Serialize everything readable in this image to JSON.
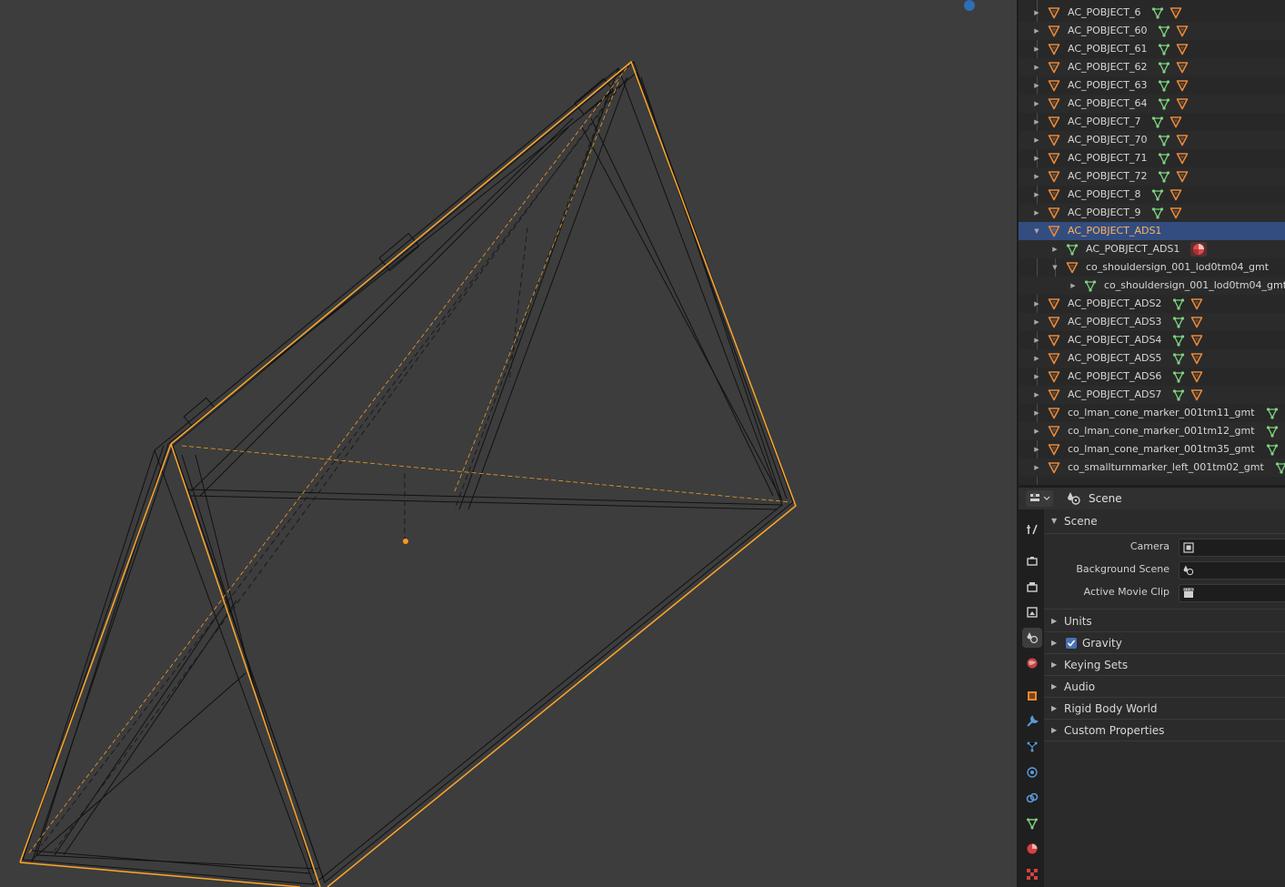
{
  "viewport": {
    "name": "3D Viewport"
  },
  "outliner": {
    "rows": [
      {
        "label": "AC_POBJECT_6",
        "indent": 0,
        "expanded": false,
        "type": "empty",
        "badges": [
          "mesh",
          "empty"
        ]
      },
      {
        "label": "AC_POBJECT_60",
        "indent": 0,
        "expanded": false,
        "type": "empty",
        "badges": [
          "mesh",
          "empty"
        ]
      },
      {
        "label": "AC_POBJECT_61",
        "indent": 0,
        "expanded": false,
        "type": "empty",
        "badges": [
          "mesh",
          "empty"
        ]
      },
      {
        "label": "AC_POBJECT_62",
        "indent": 0,
        "expanded": false,
        "type": "empty",
        "badges": [
          "mesh",
          "empty"
        ]
      },
      {
        "label": "AC_POBJECT_63",
        "indent": 0,
        "expanded": false,
        "type": "empty",
        "badges": [
          "mesh",
          "empty"
        ]
      },
      {
        "label": "AC_POBJECT_64",
        "indent": 0,
        "expanded": false,
        "type": "empty",
        "badges": [
          "mesh",
          "empty"
        ]
      },
      {
        "label": "AC_POBJECT_7",
        "indent": 0,
        "expanded": false,
        "type": "empty",
        "badges": [
          "mesh",
          "empty"
        ]
      },
      {
        "label": "AC_POBJECT_70",
        "indent": 0,
        "expanded": false,
        "type": "empty",
        "badges": [
          "mesh",
          "empty"
        ]
      },
      {
        "label": "AC_POBJECT_71",
        "indent": 0,
        "expanded": false,
        "type": "empty",
        "badges": [
          "mesh",
          "empty"
        ]
      },
      {
        "label": "AC_POBJECT_72",
        "indent": 0,
        "expanded": false,
        "type": "empty",
        "badges": [
          "mesh",
          "empty"
        ]
      },
      {
        "label": "AC_POBJECT_8",
        "indent": 0,
        "expanded": false,
        "type": "empty",
        "badges": [
          "mesh",
          "empty"
        ]
      },
      {
        "label": "AC_POBJECT_9",
        "indent": 0,
        "expanded": false,
        "type": "empty",
        "badges": [
          "mesh",
          "empty"
        ]
      },
      {
        "label": "AC_POBJECT_ADS1",
        "indent": 0,
        "expanded": true,
        "type": "empty",
        "badges": [],
        "selected": true
      },
      {
        "label": "AC_POBJECT_ADS1",
        "indent": 1,
        "expanded": false,
        "type": "mesh",
        "badges": [
          "material"
        ]
      },
      {
        "label": "co_shouldersign_001_lod0tm04_gmt",
        "indent": 1,
        "expanded": true,
        "type": "empty",
        "badges": []
      },
      {
        "label": "co_shouldersign_001_lod0tm04_gmt",
        "indent": 2,
        "expanded": false,
        "type": "mesh",
        "badges": []
      },
      {
        "label": "AC_POBJECT_ADS2",
        "indent": 0,
        "expanded": false,
        "type": "empty",
        "badges": [
          "mesh",
          "empty"
        ]
      },
      {
        "label": "AC_POBJECT_ADS3",
        "indent": 0,
        "expanded": false,
        "type": "empty",
        "badges": [
          "mesh",
          "empty"
        ]
      },
      {
        "label": "AC_POBJECT_ADS4",
        "indent": 0,
        "expanded": false,
        "type": "empty",
        "badges": [
          "mesh",
          "empty"
        ]
      },
      {
        "label": "AC_POBJECT_ADS5",
        "indent": 0,
        "expanded": false,
        "type": "empty",
        "badges": [
          "mesh",
          "empty"
        ]
      },
      {
        "label": "AC_POBJECT_ADS6",
        "indent": 0,
        "expanded": false,
        "type": "empty",
        "badges": [
          "mesh",
          "empty"
        ]
      },
      {
        "label": "AC_POBJECT_ADS7",
        "indent": 0,
        "expanded": false,
        "type": "empty",
        "badges": [
          "mesh",
          "empty"
        ]
      },
      {
        "label": "co_lman_cone_marker_001tm11_gmt",
        "indent": 0,
        "expanded": false,
        "type": "empty",
        "badges": [
          "mesh"
        ]
      },
      {
        "label": "co_lman_cone_marker_001tm12_gmt",
        "indent": 0,
        "expanded": false,
        "type": "empty",
        "badges": [
          "mesh"
        ]
      },
      {
        "label": "co_lman_cone_marker_001tm35_gmt",
        "indent": 0,
        "expanded": false,
        "type": "empty",
        "badges": [
          "mesh"
        ]
      },
      {
        "label": "co_smallturnmarker_left_001tm02_gmt",
        "indent": 0,
        "expanded": false,
        "type": "empty",
        "badges": [
          "mesh"
        ]
      }
    ]
  },
  "properties": {
    "header_context": "Scene",
    "tabs": [
      {
        "icon": "tool-icon"
      },
      {
        "icon": "render-icon"
      },
      {
        "icon": "output-icon"
      },
      {
        "icon": "view-layer-icon"
      },
      {
        "icon": "scene-icon",
        "active": true
      },
      {
        "icon": "world-icon"
      },
      {
        "icon": "object-icon"
      },
      {
        "icon": "modifier-icon"
      },
      {
        "icon": "particles-icon"
      },
      {
        "icon": "physics-icon"
      },
      {
        "icon": "constraints-icon"
      },
      {
        "icon": "data-icon"
      },
      {
        "icon": "material-icon"
      },
      {
        "icon": "texture-icon"
      }
    ],
    "scene_panel": {
      "title": "Scene",
      "camera_label": "Camera",
      "background_scene_label": "Background Scene",
      "active_movie_clip_label": "Active Movie Clip"
    },
    "panels": {
      "units": "Units",
      "gravity": "Gravity",
      "gravity_enabled": true,
      "keying_sets": "Keying Sets",
      "audio": "Audio",
      "rigid_body_world": "Rigid Body World",
      "custom_properties": "Custom Properties"
    }
  },
  "colors": {
    "selection_orange": "#ffa629",
    "empty_icon_orange": "#e8883a",
    "mesh_icon_green": "#7ed27e",
    "active_row_blue": "#334d80",
    "checkbox_blue": "#4772b3"
  }
}
